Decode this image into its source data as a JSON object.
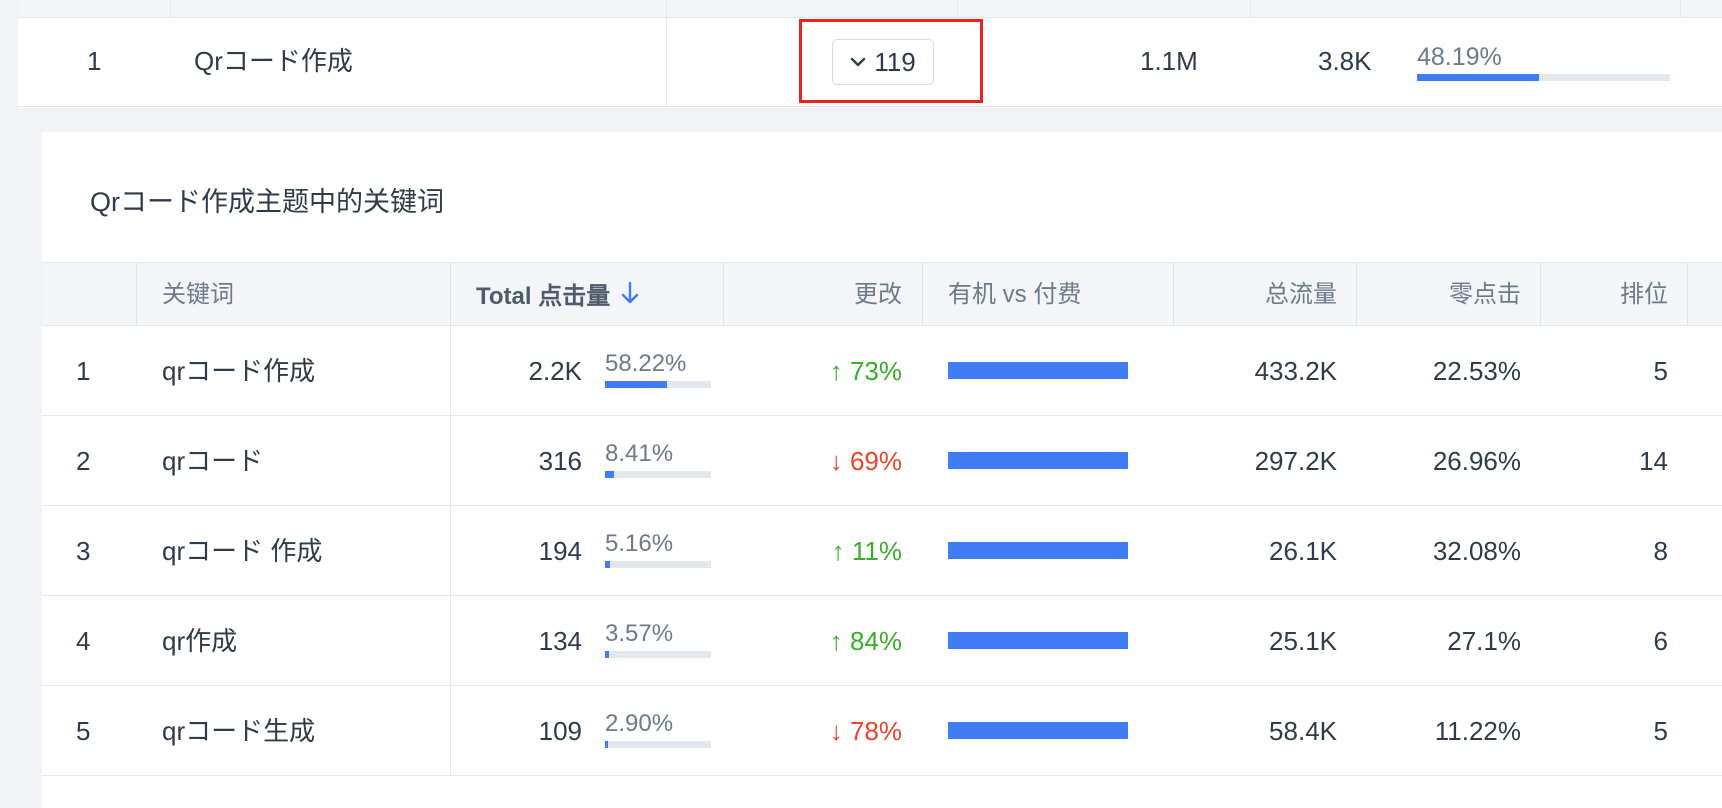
{
  "parent_row": {
    "index": "1",
    "topic": "Qrコード作成",
    "expand_count": "119",
    "volume": "1.1M",
    "clicks": "3.8K",
    "share_pct": "48.19%",
    "share_fraction": 0.4819
  },
  "panel": {
    "title": "Qrコード作成主题中的关键词",
    "headers": {
      "keyword": "关键词",
      "total_clicks": "Total 点击量",
      "change": "更改",
      "organic_vs_paid": "有机 vs 付费",
      "total_traffic": "总流量",
      "zero_click": "零点击",
      "rank": "排位"
    },
    "rows": [
      {
        "index": "1",
        "keyword": "qrコード作成",
        "clicks": "2.2K",
        "clicks_pct": "58.22%",
        "clicks_fraction": 0.5822,
        "change": "↑ 73%",
        "trend": "up",
        "organic_fraction": 1.0,
        "traffic": "433.2K",
        "zero_click": "22.53%",
        "rank": "5"
      },
      {
        "index": "2",
        "keyword": "qrコード",
        "clicks": "316",
        "clicks_pct": "8.41%",
        "clicks_fraction": 0.0841,
        "change": "↓ 69%",
        "trend": "down",
        "organic_fraction": 1.0,
        "traffic": "297.2K",
        "zero_click": "26.96%",
        "rank": "14"
      },
      {
        "index": "3",
        "keyword": "qrコード 作成",
        "clicks": "194",
        "clicks_pct": "5.16%",
        "clicks_fraction": 0.0516,
        "change": "↑ 11%",
        "trend": "up",
        "organic_fraction": 1.0,
        "traffic": "26.1K",
        "zero_click": "32.08%",
        "rank": "8"
      },
      {
        "index": "4",
        "keyword": "qr作成",
        "clicks": "134",
        "clicks_pct": "3.57%",
        "clicks_fraction": 0.0357,
        "change": "↑ 84%",
        "trend": "up",
        "organic_fraction": 1.0,
        "traffic": "25.1K",
        "zero_click": "27.1%",
        "rank": "6"
      },
      {
        "index": "5",
        "keyword": "qrコード生成",
        "clicks": "109",
        "clicks_pct": "2.90%",
        "clicks_fraction": 0.029,
        "change": "↓ 78%",
        "trend": "down",
        "organic_fraction": 1.0,
        "traffic": "58.4K",
        "zero_click": "11.22%",
        "rank": "5"
      }
    ]
  },
  "colors": {
    "accent_blue": "#3f7cf5",
    "trend_up": "#3aae2a",
    "trend_down": "#e8452c",
    "highlight_red": "#e8231b",
    "bar_track": "#e3e7ec"
  },
  "icons": {
    "expand": "chevron-down-icon",
    "sort": "arrow-down-icon"
  }
}
